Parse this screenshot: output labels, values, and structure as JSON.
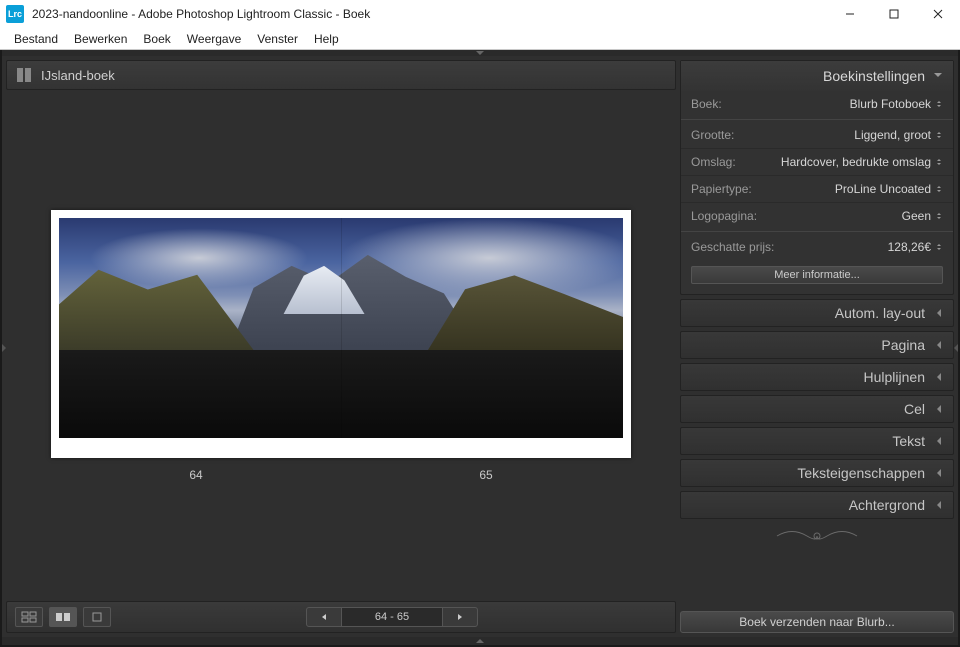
{
  "window": {
    "app_icon_text": "Lrc",
    "title": "2023-nandoonline - Adobe Photoshop Lightroom Classic - Boek"
  },
  "menu": {
    "items": [
      "Bestand",
      "Bewerken",
      "Boek",
      "Weergave",
      "Venster",
      "Help"
    ]
  },
  "collection": {
    "name": "IJsland-boek"
  },
  "pages": {
    "left": "64",
    "right": "65",
    "pager_display": "64  -  65"
  },
  "right_panel": {
    "settings_title": "Boekinstellingen",
    "rows": [
      {
        "label": "Boek:",
        "value": "Blurb Fotoboek"
      },
      {
        "label": "Grootte:",
        "value": "Liggend, groot"
      },
      {
        "label": "Omslag:",
        "value": "Hardcover, bedrukte omslag"
      },
      {
        "label": "Papiertype:",
        "value": "ProLine Uncoated"
      },
      {
        "label": "Logopagina:",
        "value": "Geen"
      }
    ],
    "price_label": "Geschatte prijs:",
    "price_value": "128,26€",
    "more_info": "Meer informatie...",
    "collapsed": [
      "Autom. lay-out",
      "Pagina",
      "Hulplijnen",
      "Cel",
      "Tekst",
      "Teksteigenschappen",
      "Achtergrond"
    ],
    "send_button": "Boek verzenden naar Blurb..."
  }
}
